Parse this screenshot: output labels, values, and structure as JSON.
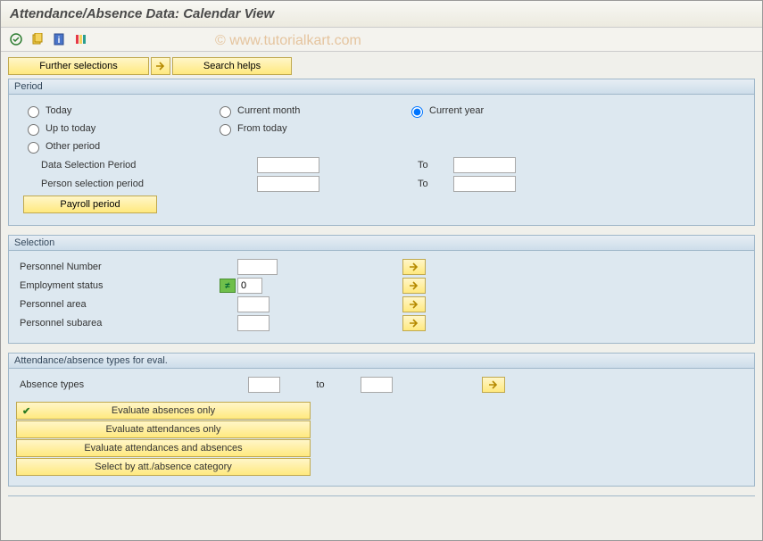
{
  "window": {
    "title": "Attendance/Absence Data: Calendar View"
  },
  "watermark": "© www.tutorialkart.com",
  "toolbar": {
    "icons": [
      "execute",
      "variant",
      "info",
      "columns"
    ]
  },
  "topButtons": {
    "further": "Further selections",
    "search": "Search helps"
  },
  "period": {
    "title": "Period",
    "radios": {
      "today": "Today",
      "current_month": "Current month",
      "current_year": "Current year",
      "up_to_today": "Up to today",
      "from_today": "From today",
      "other_period": "Other period"
    },
    "selected": "current_year",
    "data_sel": "Data Selection Period",
    "person_sel": "Person selection period",
    "to": "To",
    "payroll_btn": "Payroll period",
    "values": {
      "data_from": "",
      "data_to": "",
      "person_from": "",
      "person_to": ""
    }
  },
  "selection": {
    "title": "Selection",
    "personnel_number": "Personnel Number",
    "employment_status": "Employment status",
    "personnel_area": "Personnel area",
    "personnel_subarea": "Personnel subarea",
    "empstatus_val": "0"
  },
  "eval": {
    "title": "Attendance/absence types for eval.",
    "absence_types": "Absence types",
    "to": "to",
    "btn1": "Evaluate absences only",
    "btn2": "Evaluate attendances only",
    "btn3": "Evaluate attendances and absences",
    "btn4": "Select by att./absence category"
  }
}
